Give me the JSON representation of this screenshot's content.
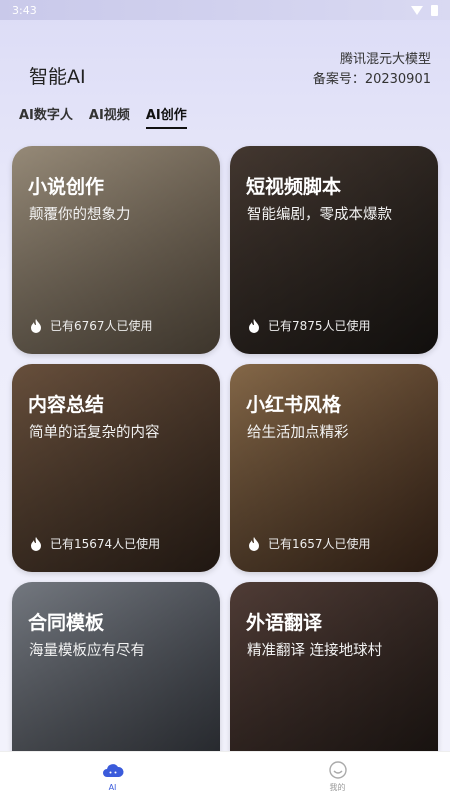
{
  "status": {
    "time": "3:43"
  },
  "header": {
    "title": "智能AI",
    "model_line1": "腾讯混元大模型",
    "model_line2": "备案号：20230901"
  },
  "tabs": [
    {
      "label": "AI数字人"
    },
    {
      "label": "AI视频"
    },
    {
      "label": "AI创作",
      "active": true
    }
  ],
  "cards": [
    {
      "title": "小说创作",
      "subtitle": "颠覆你的想象力",
      "usage": "已有6767人已使用",
      "accent": "#3f8cff",
      "bg": "#8b7b6b"
    },
    {
      "title": "短视频脚本",
      "subtitle": "智能编剧，零成本爆款",
      "usage": "已有7875人已使用",
      "accent": "#8a5cff",
      "bg": "#3a342f"
    },
    {
      "title": "内容总结",
      "subtitle": "简单的话复杂的内容",
      "usage": "已有15674人已使用",
      "accent": "#b84dff",
      "bg": "#6b4f3a"
    },
    {
      "title": "小红书风格",
      "subtitle": "给生活加点精彩",
      "usage": "已有1657人已使用",
      "accent": "#22c9a6",
      "bg": "#7a5a3a"
    },
    {
      "title": "合同模板",
      "subtitle": "海量模板应有尽有",
      "usage": "",
      "accent": "#3fa0ff",
      "bg": "#5f6470"
    },
    {
      "title": "外语翻译",
      "subtitle": "精准翻译 连接地球村",
      "usage": "",
      "accent": "#ff9a2e",
      "bg": "#4a3a34"
    }
  ],
  "nav": [
    {
      "label": "AI",
      "active": true
    },
    {
      "label": "我的",
      "active": false
    }
  ]
}
